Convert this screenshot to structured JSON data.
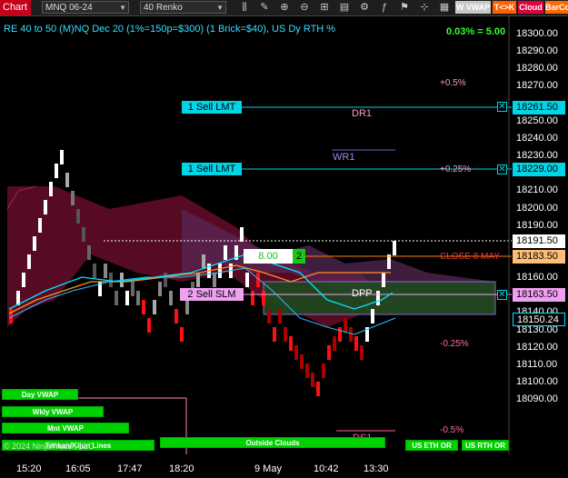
{
  "toolbar": {
    "chart_label": "Chart",
    "instrument": "MNQ 06-24",
    "bar_type": "40 Renko",
    "icons": [
      "bar-style-icon",
      "draw-icon",
      "zoom-in-icon",
      "zoom-out-icon",
      "properties-icon",
      "templates-icon",
      "strategies-icon",
      "indicators-icon",
      "flag-icon",
      "pin-icon",
      "drawing-tools-icon",
      "data-box-icon"
    ],
    "buttons": [
      {
        "label": "W VWAP",
        "bg": "#c8c8c8",
        "fg": "#ffffff"
      },
      {
        "label": "T<>K",
        "bg": "#ff5f00",
        "fg": "#ffffff"
      },
      {
        "label": "Cloud",
        "bg": "#e0003c",
        "fg": "#ffffff"
      },
      {
        "label": "BarCo",
        "bg": "#ff6a00",
        "fg": "#ffffff"
      }
    ]
  },
  "chart": {
    "title": "RE 40 to 50 (M)NQ Dec 20 (1%=150p=$300) (1 Brick=$40), US Dy RTH %",
    "pct_change": "0.03% = 5.00",
    "price_axis": [
      "18300.00",
      "18290.00",
      "18280.00",
      "18270.00",
      "18250.00",
      "18240.00",
      "18230.00",
      "18220.00",
      "18210.00",
      "18200.00",
      "18190.00",
      "18180.00",
      "18170.00",
      "18160.00",
      "18150.00",
      "18140.00",
      "18130.00",
      "18120.00",
      "18110.00",
      "18100.00",
      "18090.00"
    ],
    "time_axis": [
      "15:20",
      "16:05",
      "17:47",
      "18:20",
      "9 May",
      "10:42",
      "13:30"
    ],
    "orders": [
      {
        "label": "1 Sell LMT",
        "price": "18261.50"
      },
      {
        "label": "1 Sell LMT",
        "price": "18229.00"
      },
      {
        "label": "2 Sell SLM",
        "price": "18163.50"
      }
    ],
    "last_price": "18191.50",
    "close_price": "18183.50",
    "lower_price": "18150.24",
    "position_qty": "8.00",
    "position_count": "2",
    "levels": {
      "plus_05": "+0.5%",
      "plus_025": "+0.25%",
      "close_label": "CLOSE 8 MAY",
      "minus_025": "-0.25%",
      "minus_05": "-0.5%"
    },
    "pivots": {
      "dr1": "DR1",
      "wr1": "WR1",
      "dpp": "DPP",
      "ds1": "DS1"
    },
    "buttons_left": [
      "Day VWAP",
      "Wkly VWAP",
      "Mnt VWAP",
      "Tenkan/Kijun Lines"
    ],
    "outside_clouds": "Outside Clouds",
    "us_eth_or": "US ETH OR",
    "us_rth_or": "US RTH OR",
    "copyright": "© 2024 NinjaTrader, LLC"
  },
  "colors": {
    "cyan": "#00e5ff",
    "up_brick": "#ffffff",
    "down_brick": "#ff1010",
    "cloud_red": "#7a1030",
    "cloud_purple": "#5a2a5a",
    "order_bg": "#00d5e6",
    "sell_slm_bg": "#f0a0f0",
    "close_line": "#ff8000",
    "green_btn": "#00d100"
  }
}
